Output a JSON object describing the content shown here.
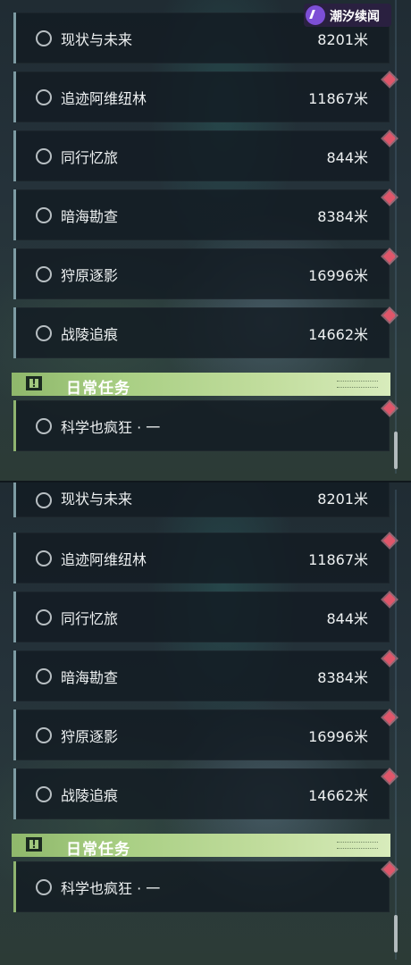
{
  "badge": {
    "text": "潮汐续闻"
  },
  "quests": [
    {
      "name": "现状与未来",
      "distance": "8201米"
    },
    {
      "name": "追迹阿维纽林",
      "distance": "11867米"
    },
    {
      "name": "同行忆旅",
      "distance": "844米"
    },
    {
      "name": "暗海勘查",
      "distance": "8384米"
    },
    {
      "name": "狩原逐影",
      "distance": "16996米"
    },
    {
      "name": "战陵追痕",
      "distance": "14662米"
    }
  ],
  "daily": {
    "header": "日常任务",
    "items": [
      {
        "name": "科学也疯狂 · 一",
        "distance": ""
      }
    ]
  },
  "colors": {
    "tracked_marker": "#e0566a",
    "daily_accent": "#a9cf84",
    "quest_bar": "#7d9ba3",
    "badge_logo": "#7d4fd6"
  }
}
